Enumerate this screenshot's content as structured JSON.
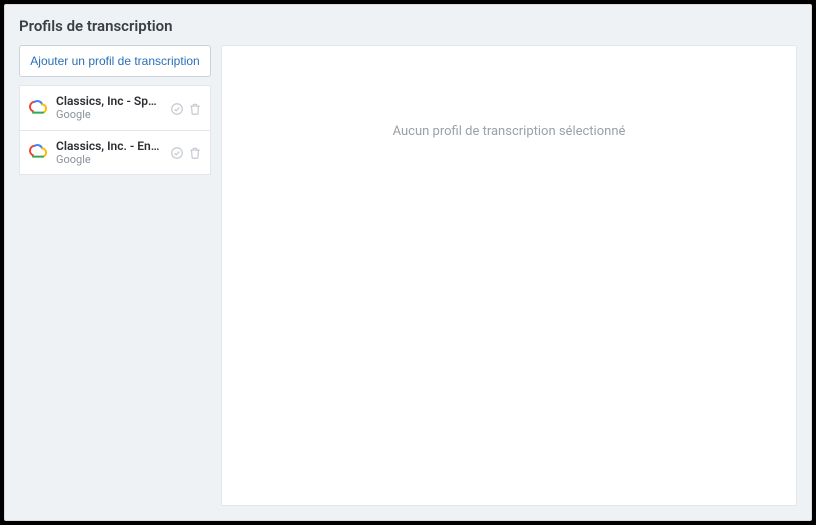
{
  "header": {
    "title": "Profils de transcription"
  },
  "sidebar": {
    "add_button_label": "Ajouter un profil de transcription",
    "items": [
      {
        "name": "Classics, Inc - Spanish",
        "provider": "Google"
      },
      {
        "name": "Classics, Inc. - English",
        "provider": "Google"
      }
    ]
  },
  "main": {
    "empty_message": "Aucun profil de transcription sélectionné"
  }
}
